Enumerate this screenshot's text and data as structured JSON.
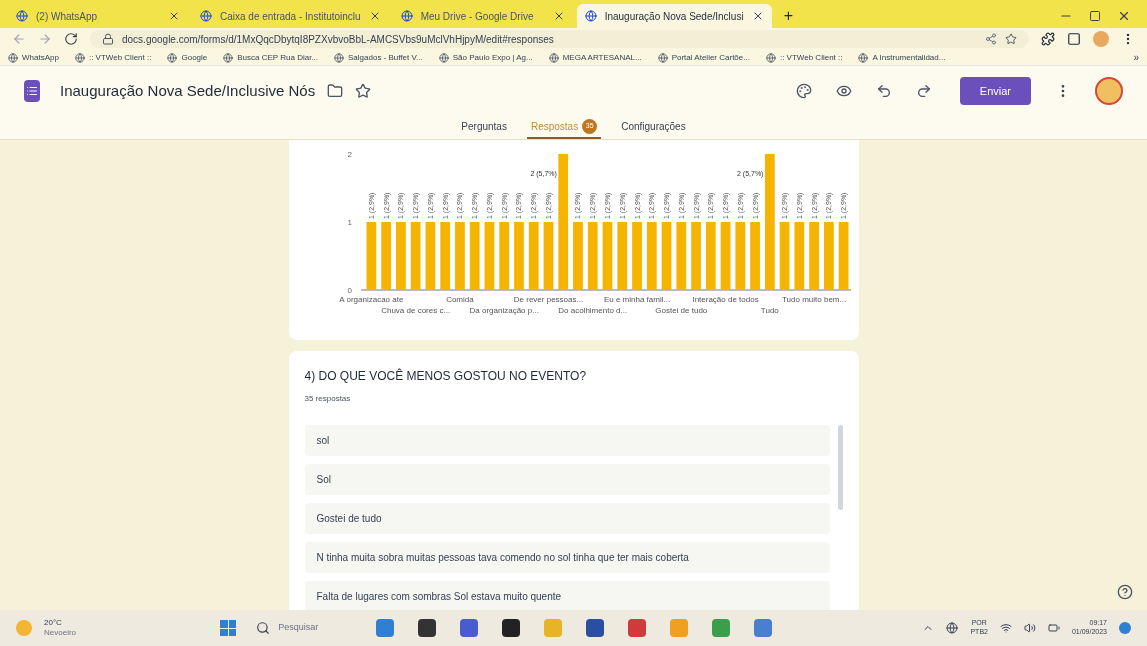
{
  "browser_tabs": [
    {
      "title": "(2) WhatsApp",
      "selected": false
    },
    {
      "title": "Caixa de entrada - Institutoinclu",
      "selected": false
    },
    {
      "title": "Meu Drive - Google Drive",
      "selected": false
    },
    {
      "title": "Inauguração Nova Sede/Inclusi",
      "selected": true
    }
  ],
  "new_tab": "+",
  "address": "docs.google.com/forms/d/1MxQqcDbytqI8PZXvbvoBbL-AMCSVbs9uMclVhHjpyM/edit#responses",
  "bookmarks": [
    "WhatsApp",
    ":: VTWeb Client ::",
    "Google",
    "Busca CEP Rua Diar...",
    "Salgados - Buffet V...",
    "São Paulo Expo | Ag...",
    "MEGA ARTESANAL...",
    "Portal Atelier Cartõe...",
    ":: VTWeb Client ::",
    "A Instrumentalidad..."
  ],
  "bookmarks_more": "»",
  "form_title": "Inauguração Nova Sede/Inclusive Nós",
  "send_button": "Enviar",
  "form_tabs": [
    {
      "label": "Perguntas",
      "selected": false
    },
    {
      "label": "Respostas",
      "selected": true,
      "badge": "35"
    },
    {
      "label": "Configurações",
      "selected": false
    }
  ],
  "chart_card": {
    "chart_data": {
      "type": "bar",
      "ylim": [
        0,
        2
      ],
      "yticks": [
        0,
        1,
        2
      ],
      "categories": [
        "A organizacao ate",
        null,
        null,
        "Chuva de cores c...",
        null,
        null,
        "Comida",
        null,
        null,
        "Da organização p...",
        null,
        null,
        "De rever pessoas...",
        null,
        null,
        "Do acolhimento d...",
        null,
        null,
        "Eu e minha famil...",
        null,
        null,
        "Gostei de tudo",
        null,
        null,
        "Interação de todos",
        null,
        null,
        "Tudo",
        null,
        null,
        "Tudo muito bem...",
        null,
        null
      ],
      "series": [
        {
          "color": "#f4b400",
          "values": [
            1,
            1,
            1,
            1,
            1,
            1,
            1,
            1,
            1,
            1,
            1,
            1,
            1,
            2,
            1,
            1,
            1,
            1,
            1,
            1,
            1,
            1,
            1,
            1,
            1,
            1,
            1,
            2,
            1,
            1,
            1,
            1,
            1
          ]
        }
      ],
      "value_labels": [
        "1 (2,9%)",
        "1 (2,9%)",
        "1 (2,9%)",
        "1 (2,9%)",
        "1 (2,9%)",
        "1 (2,9%)",
        "1 (2,9%)",
        "1 (2,9%)",
        "1 (2,9%)",
        "1 (2,9%)",
        "1 (2,9%)",
        "1 (2,9%)",
        "1 (2,9%)",
        "2 (5,7%)",
        "1 (2,9%)",
        "1 (2,9%)",
        "1 (2,9%)",
        "1 (2,9%)",
        "1 (2,9%)",
        "1 (2,9%)",
        "1 (2,9%)",
        "1 (2,9%)",
        "1 (2,9%)",
        "1 (2,9%)",
        "1 (2,9%)",
        "1 (2,9%)",
        "1 (2,9%)",
        "2 (5,7%)",
        "1 (2,9%)",
        "1 (2,9%)",
        "1 (2,9%)",
        "1 (2,9%)",
        "1 (2,9%)"
      ]
    }
  },
  "question_card": {
    "title": "4) DO QUE VOCÊ MENOS GOSTOU NO EVENTO?",
    "count": "35 respostas",
    "answers": [
      "sol",
      "Sol",
      "Gostei de tudo",
      "N tinha muita sobra muitas pessoas tava comendo no sol tinha que ter mais coberta",
      "Falta de lugares com sombras Sol estava muito quente"
    ]
  },
  "taskbar": {
    "weather_temp": "20°C",
    "weather_text": "Nevoeiro",
    "search": "Pesquisar",
    "lang": "POR",
    "layout": "PTB2",
    "time": "09:17",
    "date": "01/09/2023"
  }
}
